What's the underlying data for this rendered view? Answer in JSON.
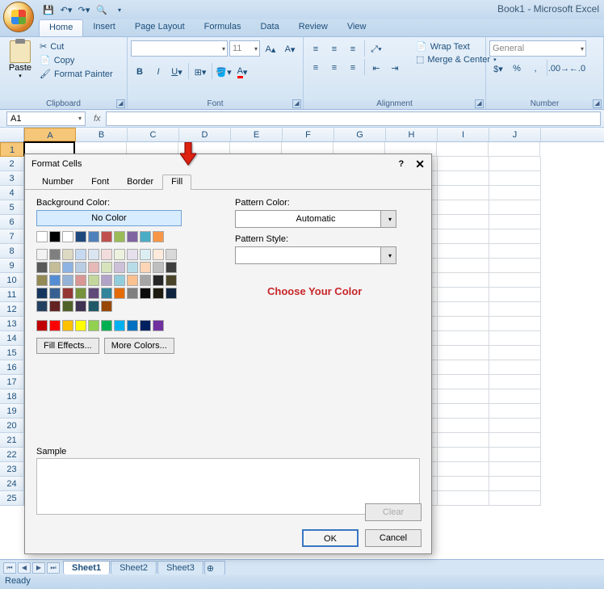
{
  "app_title": "Book1 - Microsoft Excel",
  "qat_icons": [
    "save-icon",
    "undo-icon",
    "redo-icon",
    "print-icon"
  ],
  "tabs": [
    "Home",
    "Insert",
    "Page Layout",
    "Formulas",
    "Data",
    "Review",
    "View"
  ],
  "active_tab": "Home",
  "clipboard": {
    "paste": "Paste",
    "cut": "Cut",
    "copy": "Copy",
    "fp": "Format Painter",
    "label": "Clipboard"
  },
  "font": {
    "family_placeholder": "",
    "size": "11",
    "label": "Font"
  },
  "alignment": {
    "wrap": "Wrap Text",
    "merge": "Merge & Center",
    "label": "Alignment"
  },
  "number": {
    "general": "General",
    "label": "Number"
  },
  "namebox": "A1",
  "columns": [
    "",
    "A",
    "B",
    "C",
    "D",
    "E",
    "F",
    "G",
    "H",
    "I",
    "J"
  ],
  "rows": [
    "1",
    "2",
    "3",
    "4",
    "5",
    "6",
    "7",
    "8",
    "9",
    "10",
    "11",
    "12",
    "13",
    "14",
    "15",
    "16",
    "17",
    "18",
    "19",
    "20",
    "21",
    "22",
    "23",
    "24",
    "25"
  ],
  "sheets": [
    "Sheet1",
    "Sheet2",
    "Sheet3"
  ],
  "status": "Ready",
  "dialog": {
    "title": "Format Cells",
    "tabs": [
      "Number",
      "Font",
      "Border",
      "Fill"
    ],
    "active_tab": "Fill",
    "bg_label": "Background Color:",
    "no_color": "No Color",
    "fill_effects": "Fill Effects...",
    "more_colors": "More Colors...",
    "pattern_color": "Pattern Color:",
    "pattern_auto": "Automatic",
    "pattern_style": "Pattern Style:",
    "choose": "Choose Your Color",
    "sample": "Sample",
    "clear": "Clear",
    "ok": "OK",
    "cancel": "Cancel",
    "row1": [
      "#FFFFFF",
      "#000000",
      "#FFFFFF",
      "#1F497D",
      "#4F81BD",
      "#C0504D",
      "#9BBB59",
      "#8064A2",
      "#4BACC6",
      "#F79646"
    ],
    "theme": [
      [
        "#F2F2F2",
        "#7F7F7F",
        "#DDD9C3",
        "#C6D9F0",
        "#DBE5F1",
        "#F2DCDB",
        "#EBF1DD",
        "#E5E0EC",
        "#DBEEF3",
        "#FDEADA"
      ],
      [
        "#D8D8D8",
        "#595959",
        "#C4BD97",
        "#8DB3E2",
        "#B8CCE4",
        "#E5B9B7",
        "#D7E3BC",
        "#CCC1D9",
        "#B7DDE8",
        "#FBD5B5"
      ],
      [
        "#BFBFBF",
        "#3F3F3F",
        "#938953",
        "#548DD4",
        "#95B3D7",
        "#D99694",
        "#C3D69B",
        "#B2A2C7",
        "#92CDDC",
        "#FAC08F"
      ],
      [
        "#A5A5A5",
        "#262626",
        "#494429",
        "#17365D",
        "#366092",
        "#953734",
        "#76923C",
        "#5F497A",
        "#31859B",
        "#E36C09"
      ],
      [
        "#7F7F7F",
        "#0C0C0C",
        "#1D1B10",
        "#0F243E",
        "#244061",
        "#632423",
        "#4F6128",
        "#3F3151",
        "#205867",
        "#974806"
      ]
    ],
    "standard": [
      "#C00000",
      "#FF0000",
      "#FFC000",
      "#FFFF00",
      "#92D050",
      "#00B050",
      "#00B0F0",
      "#0070C0",
      "#002060",
      "#7030A0"
    ]
  }
}
